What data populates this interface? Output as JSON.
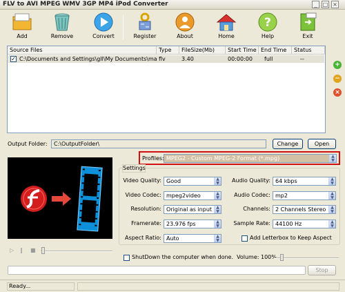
{
  "window": {
    "title": "FLV to AVI MPEG WMV 3GP MP4 iPod Converter"
  },
  "toolbar": {
    "add": {
      "label": "Add",
      "icon": "add-folder-icon"
    },
    "remove": {
      "label": "Remove",
      "icon": "trash-icon"
    },
    "convert": {
      "label": "Convert",
      "icon": "play-icon"
    },
    "register": {
      "label": "Register",
      "icon": "key-icon"
    },
    "about": {
      "label": "About",
      "icon": "person-icon"
    },
    "home": {
      "label": "Home",
      "icon": "home-icon"
    },
    "help": {
      "label": "Help",
      "icon": "help-icon"
    },
    "exit": {
      "label": "Exit",
      "icon": "exit-door-icon"
    }
  },
  "file_list": {
    "columns": [
      "Source Files",
      "Type",
      "FileSize(Mb)",
      "Start Time",
      "End Time",
      "Status"
    ],
    "rows": [
      {
        "checked": true,
        "source": "C:\\Documents and Settings\\gll\\My Documents\\material\\dest...",
        "type": "flv",
        "size": "3.40",
        "start": "00:00:00",
        "end": "full",
        "status": "--"
      }
    ]
  },
  "output": {
    "label": "Output Folder:",
    "path": "C:\\OutputFolder\\",
    "change_label": "Change",
    "open_label": "Open"
  },
  "profiles": {
    "label": "Profiles:",
    "value": "MPEG2 - Custom MPEG-2 Format (*.mpg)"
  },
  "settings": {
    "tab_label": "Settings",
    "video_quality": {
      "label": "Video Quality:",
      "value": "Good"
    },
    "video_codec": {
      "label": "Video Codec:",
      "value": "mpeg2video"
    },
    "resolution": {
      "label": "Resolution:",
      "value": "Original as input"
    },
    "framerate": {
      "label": "Framerate:",
      "value": "23.976 fps"
    },
    "aspect_ratio": {
      "label": "Aspect Ratio:",
      "value": "Auto"
    },
    "audio_quality": {
      "label": "Audio Quality:",
      "value": "64  kbps"
    },
    "audio_codec": {
      "label": "Audio Codec:",
      "value": "mp2"
    },
    "channels": {
      "label": "Channels:",
      "value": "2 Channels Stereo"
    },
    "sample_rate": {
      "label": "Sample Rate:",
      "value": "44100 Hz"
    },
    "letterbox": {
      "label": "Add Letterbox to Keep Aspect",
      "checked": false
    }
  },
  "bottom": {
    "shutdown_label": "ShutDown the computer when done.",
    "volume_label": "Volume: 100%",
    "volume_level": 0.1,
    "stop_label": "Stop"
  },
  "status": {
    "text": "Ready..."
  },
  "colors": {
    "accent_blue": "#3c6fd6",
    "profile_highlight": "#d3c1a6",
    "profile_border": "#d01010",
    "play_arrow": "#e8483a"
  }
}
